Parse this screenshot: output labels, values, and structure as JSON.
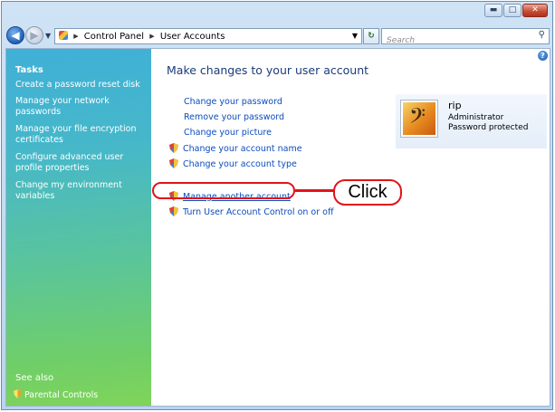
{
  "window": {
    "minimize_glyph": "▬",
    "maximize_glyph": "□",
    "close_glyph": "✕"
  },
  "navbar": {
    "back_glyph": "◀",
    "forward_glyph": "▶",
    "breadcrumb": [
      "Control Panel",
      "User Accounts"
    ],
    "refresh_glyph": "↻",
    "search_placeholder": "Search"
  },
  "sidebar": {
    "tasks_heading": "Tasks",
    "links": [
      "Create a password reset disk",
      "Manage your network passwords",
      "Manage your file encryption certificates",
      "Configure advanced user profile properties",
      "Change my environment variables"
    ],
    "see_also_heading": "See also",
    "parental_controls": "Parental Controls"
  },
  "main": {
    "title": "Make changes to your user account",
    "links": [
      "Change your password",
      "Remove your password",
      "Change your picture",
      "Change your account name",
      "Change your account type",
      "Manage another account",
      "Turn User Account Control on or off"
    ],
    "help_glyph": "?"
  },
  "user": {
    "name": "rip",
    "role": "Administrator",
    "status": "Password protected"
  },
  "callout": {
    "label": "Click"
  },
  "icons": [
    "back-icon",
    "forward-icon",
    "control-panel-icon",
    "refresh-icon",
    "search-icon",
    "help-icon",
    "shield-icon",
    "user-picture"
  ],
  "colors": {
    "link": "#0b4cbf",
    "title": "#1b3b78",
    "callout": "#e1141b"
  }
}
